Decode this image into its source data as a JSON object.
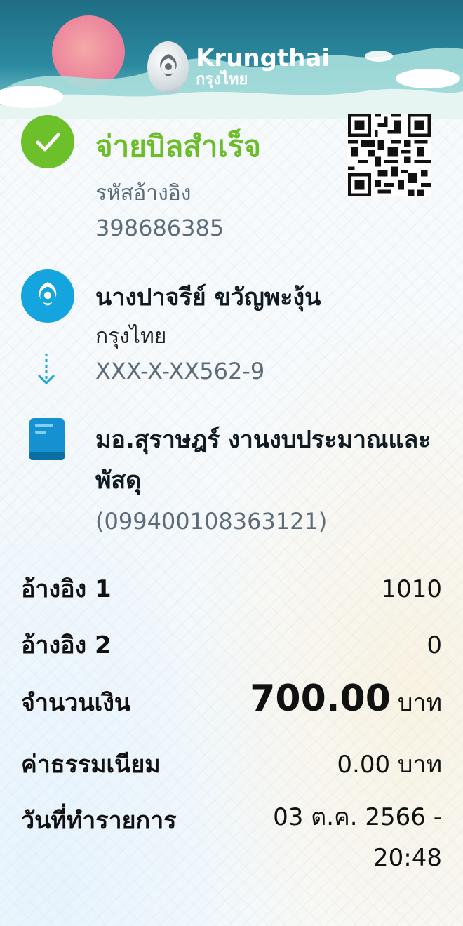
{
  "header": {
    "brand_name": "Krungthai",
    "brand_thai": "กรุงไทย"
  },
  "status": {
    "title": "จ่ายบิลสำเร็จ",
    "ref_label": "รหัสอ้างอิง",
    "ref_value": "398686385"
  },
  "sender": {
    "name": "นางปาจรีย์ ขวัญพะงุ้น",
    "bank": "กรุงไทย",
    "account": "XXX-X-XX562-9"
  },
  "biller": {
    "name": "มอ.สุราษฎร์ งานงบประมาณและพัสดุ",
    "id": "(099400108363121)"
  },
  "details": {
    "ref1_label": "อ้างอิง 1",
    "ref1_value": "1010",
    "ref2_label": "อ้างอิง 2",
    "ref2_value": "0",
    "amount_label": "จำนวนเงิน",
    "amount_value": "700.00",
    "amount_unit": "บาท",
    "fee_label": "ค่าธรรมเนียม",
    "fee_value": "0.00 บาท",
    "date_label": "วันที่ทำรายการ",
    "date_value_line1": "03 ต.ค. 2566 -",
    "date_value_line2": "20:48"
  },
  "colors": {
    "success_green": "#6cbd2a",
    "brand_blue": "#14a4de",
    "muted_text": "#5c6b78"
  }
}
